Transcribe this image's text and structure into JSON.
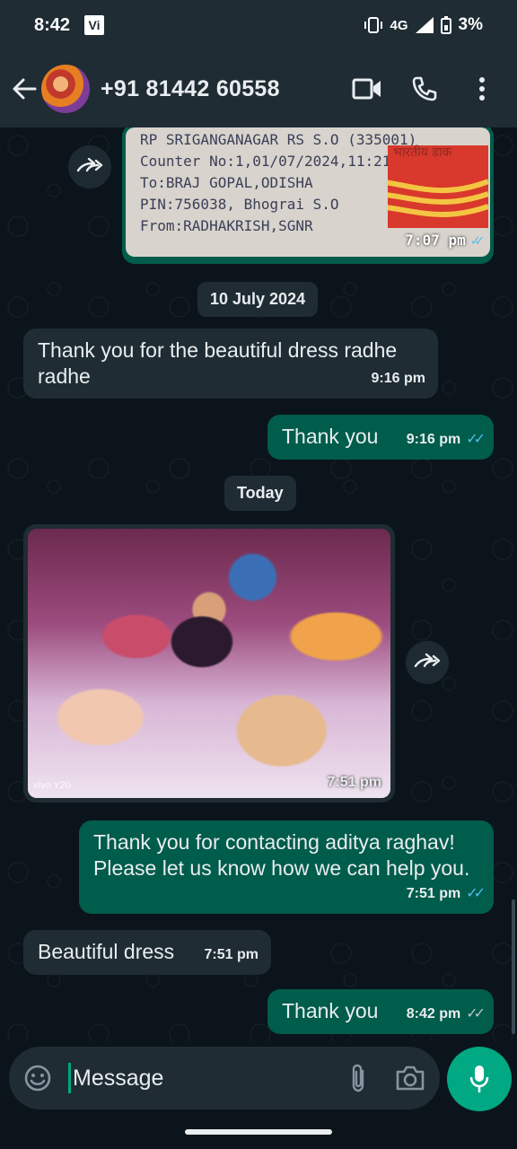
{
  "status_bar": {
    "time": "8:42",
    "carrier_badge": "Vi",
    "network": "4G",
    "battery": "3%"
  },
  "header": {
    "contact_name": "+91 81442 60558",
    "icons": [
      "back-arrow-icon",
      "video-call-icon",
      "voice-call-icon",
      "more-vert-icon"
    ]
  },
  "messages": {
    "receipt_image": {
      "lines": [
        "RP SRIGANGANAGAR RS S.O (335001)",
        "Counter No:1,01/07/2024,11:21",
        "To:BRAJ GOPAL,ODISHA",
        "PIN:756038, Bhograi S.O",
        "From:RADHAKRISH,SGNR"
      ],
      "logo_text": "भारतीय डाक",
      "time": "7:07 pm"
    },
    "date1": "10 July 2024",
    "m1": {
      "text": "Thank you for the beautiful dress radhe radhe",
      "time": "9:16 pm"
    },
    "m2": {
      "text": "Thank you",
      "time": "9:16 pm"
    },
    "date2": "Today",
    "photo": {
      "watermark": "vivo Y20",
      "time": "7:51 pm"
    },
    "m3": {
      "text": "Thank you for contacting aditya raghav! Please let us know how we can help you.",
      "time": "7:51 pm"
    },
    "m4": {
      "text": "Beautiful dress",
      "time": "7:51 pm"
    },
    "m5": {
      "text": "Thank you",
      "time": "8:42 pm"
    }
  },
  "composer": {
    "placeholder": "Message"
  },
  "colors": {
    "outgoing": "#005c4b",
    "incoming": "#1f2c34",
    "accent": "#00a884",
    "read_ticks": "#53bdeb"
  }
}
